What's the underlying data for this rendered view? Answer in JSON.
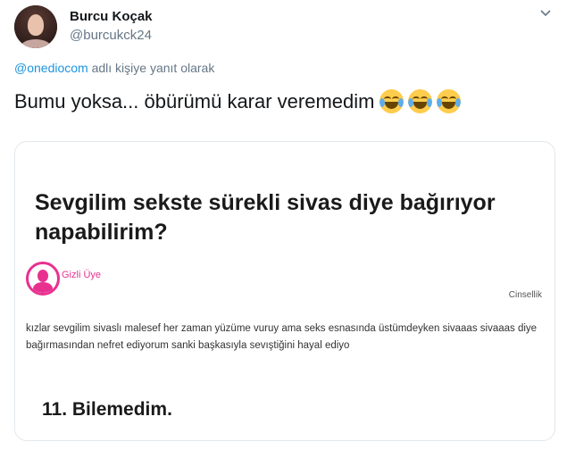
{
  "tweet": {
    "author_name": "Burcu Koçak",
    "author_handle": "@burcukck24",
    "reply_mention": "@onediocom",
    "reply_suffix": " adlı kişiye yanıt olarak",
    "text": "Bumu yoksa... öbürümü karar veremedim",
    "emoji_count": 3,
    "emoji_icon": "face-with-tears-of-joy-icon"
  },
  "card": {
    "question_title": "Sevgilim sekste sürekli sivas diye bağırıyor napabilirim?",
    "poster_name": "Gizli Üye",
    "category": "Cinsellik",
    "question_body": "kızlar sevgilim sivaslı malesef her zaman yüzüme vuruy ama seks esnasında üstümdeyken sivaaas sivaaas diye bağırmasından nefret ediyorum sanki başkasıyla sevıştiğini hayal ediyo",
    "answer_label": "11. Bilemedim."
  },
  "colors": {
    "mention": "#1b95e0",
    "secondary_text": "#657786",
    "brand_pink": "#e8318f"
  }
}
